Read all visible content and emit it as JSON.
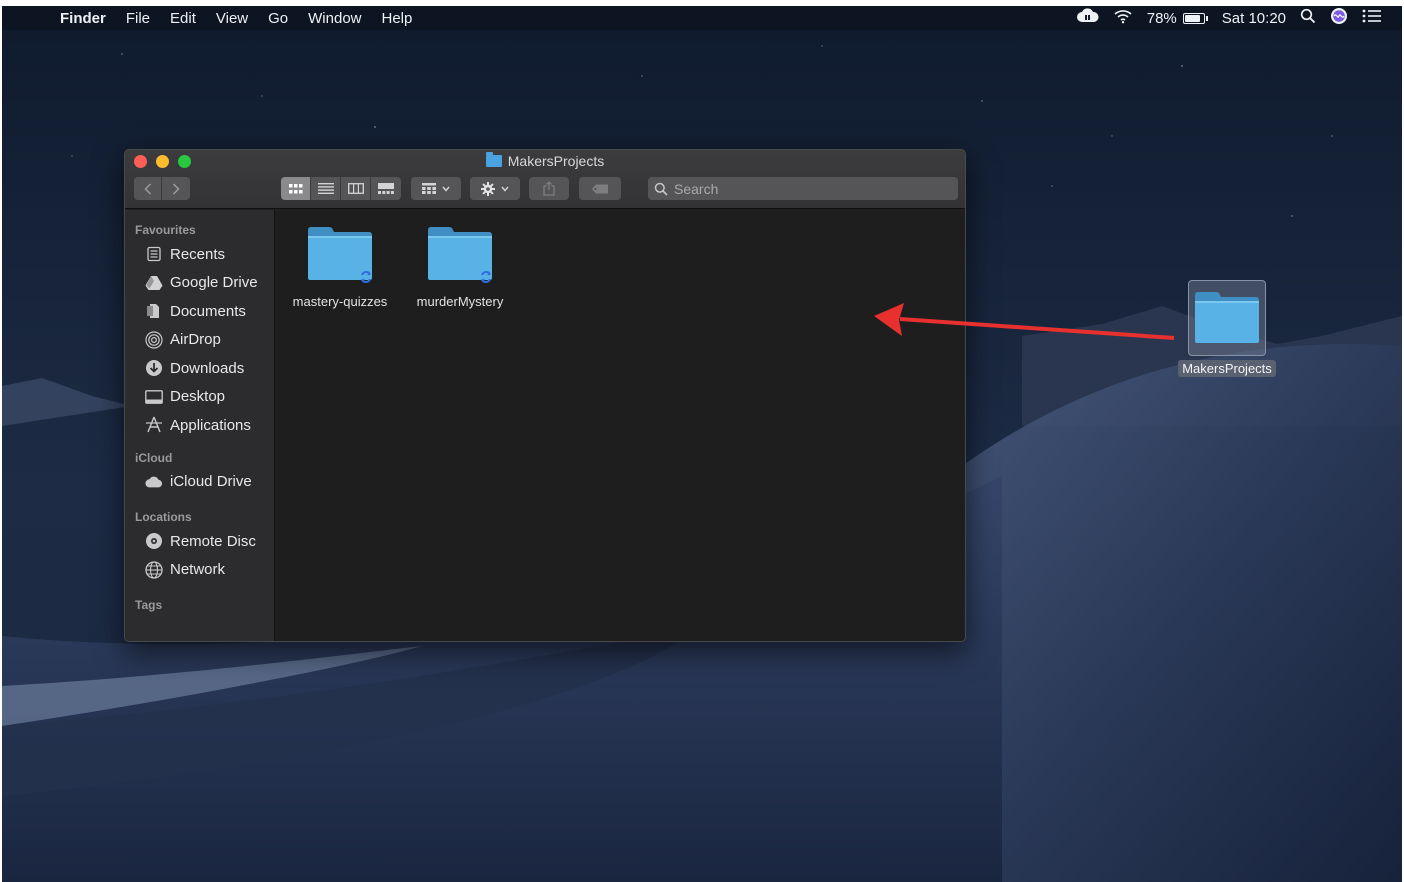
{
  "menubar": {
    "apple_glyph": "",
    "app_name": "Finder",
    "menus": [
      "File",
      "Edit",
      "View",
      "Go",
      "Window",
      "Help"
    ],
    "battery_percent": "78%",
    "battery_level": 0.78,
    "clock": "Sat 10:20",
    "icons": [
      "creative-cloud-icon",
      "wifi-icon",
      "battery-icon",
      "spotlight-search-icon",
      "siri-icon",
      "notification-center-icon"
    ]
  },
  "window": {
    "title": "MakersProjects",
    "search_placeholder": "Search",
    "active_view": "icon",
    "sidebar": {
      "sections": [
        {
          "heading": "Favourites",
          "items": [
            {
              "label": "Recents",
              "icon": "recents-icon"
            },
            {
              "label": "Google Drive",
              "icon": "google-drive-icon"
            },
            {
              "label": "Documents",
              "icon": "documents-icon"
            },
            {
              "label": "AirDrop",
              "icon": "airdrop-icon"
            },
            {
              "label": "Downloads",
              "icon": "downloads-icon"
            },
            {
              "label": "Desktop",
              "icon": "desktop-icon"
            },
            {
              "label": "Applications",
              "icon": "applications-icon"
            }
          ]
        },
        {
          "heading": "iCloud",
          "items": [
            {
              "label": "iCloud Drive",
              "icon": "cloud-icon"
            }
          ]
        },
        {
          "heading": "Locations",
          "items": [
            {
              "label": "Remote Disc",
              "icon": "disc-icon"
            },
            {
              "label": "Network",
              "icon": "network-icon"
            }
          ]
        },
        {
          "heading": "Tags",
          "items": []
        }
      ]
    },
    "files": [
      {
        "name": "mastery-quizzes",
        "icon": "folder-icon",
        "badge": "sync-icon"
      },
      {
        "name": "murderMystery",
        "icon": "folder-icon",
        "badge": "sync-icon"
      }
    ]
  },
  "desktop": {
    "folder": {
      "name": "MakersProjects",
      "icon": "folder-icon",
      "selected": true
    },
    "annotation": {
      "type": "arrow",
      "color": "#e8312f"
    }
  }
}
